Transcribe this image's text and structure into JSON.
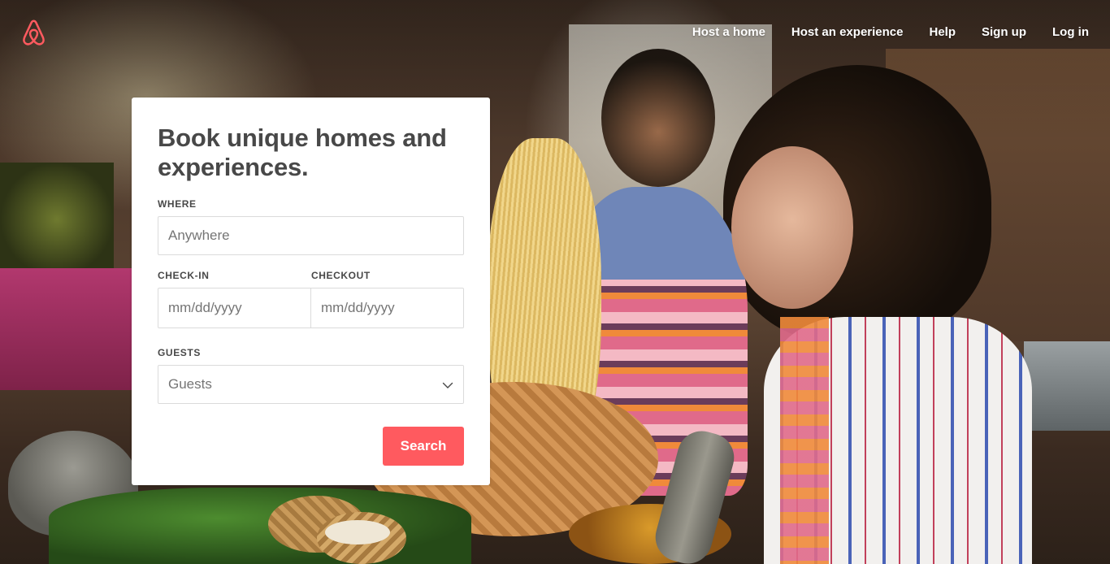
{
  "brand": {
    "logo_icon": "airbnb-belo-icon",
    "accent": "#ff5a5f"
  },
  "nav": {
    "items": [
      {
        "label": "Host a home"
      },
      {
        "label": "Host an experience"
      },
      {
        "label": "Help"
      },
      {
        "label": "Sign up"
      },
      {
        "label": "Log in"
      }
    ]
  },
  "booking": {
    "title": "Book unique homes and experiences.",
    "where": {
      "label": "Where",
      "placeholder": "Anywhere",
      "value": ""
    },
    "checkin": {
      "label": "Check-in",
      "placeholder": "mm/dd/yyyy",
      "value": ""
    },
    "checkout": {
      "label": "Checkout",
      "placeholder": "mm/dd/yyyy",
      "value": ""
    },
    "guests": {
      "label": "Guests",
      "selected": "Guests",
      "icon": "chevron-down-icon"
    },
    "search_label": "Search"
  }
}
